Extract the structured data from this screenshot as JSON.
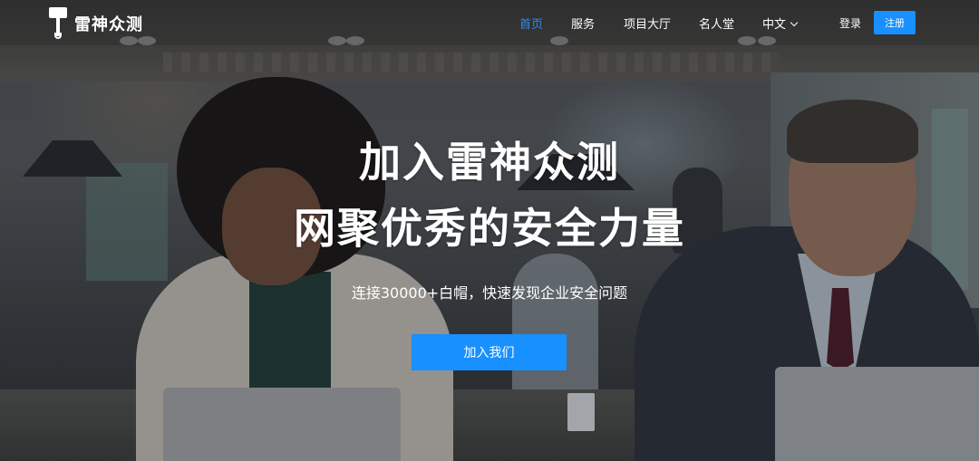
{
  "brand": {
    "name": "雷神众测",
    "icon": "thor-hammer-icon"
  },
  "nav": {
    "items": [
      {
        "label": "首页",
        "active": true
      },
      {
        "label": "服务",
        "active": false
      },
      {
        "label": "项目大厅",
        "active": false
      },
      {
        "label": "名人堂",
        "active": false
      }
    ],
    "language": "中文",
    "login": "登录",
    "register": "注册"
  },
  "hero": {
    "title_line1": "加入雷神众测",
    "title_line2": "网聚优秀的安全力量",
    "subtitle": "连接30000+白帽，快速发现企业安全问题",
    "cta": "加入我们"
  },
  "colors": {
    "accent": "#1890ff",
    "active_nav": "#2d8cf0",
    "text": "#ffffff"
  }
}
